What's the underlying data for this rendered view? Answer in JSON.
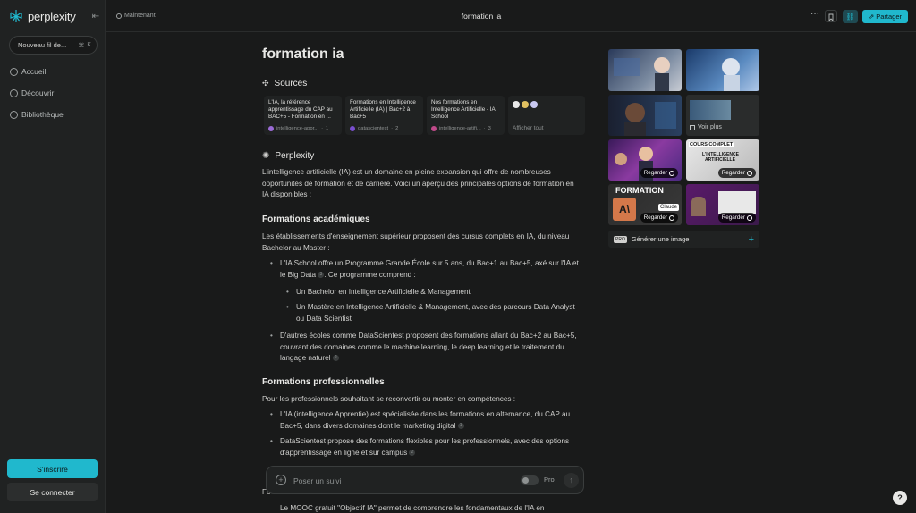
{
  "sidebar": {
    "brand": "perplexity",
    "new_thread": "Nouveau fil de...",
    "new_thread_kbd": "⌘",
    "new_thread_kbd2": "K",
    "items": [
      {
        "label": "Accueil",
        "icon": "search-icon"
      },
      {
        "label": "Découvrir",
        "icon": "globe-icon"
      },
      {
        "label": "Bibliothèque",
        "icon": "library-icon"
      }
    ],
    "signup": "S'inscrire",
    "login": "Se connecter"
  },
  "topbar": {
    "time": "Maintenant",
    "title": "formation ia",
    "share": "Partager"
  },
  "query": "formation ia",
  "sources": {
    "heading": "Sources",
    "cards": [
      {
        "title": "L'IA, la référence apprentissage du CAP au BAC+5 - Formation en ...",
        "domain": "intelligence-appr...",
        "num": "1"
      },
      {
        "title": "Formations en Intelligence Artificielle (IA) | Bac+2 à Bac+5",
        "domain": "datascientest",
        "num": "2"
      },
      {
        "title": "Nos formations en Intelligence Artificielle - IA School",
        "domain": "intelligence-artifi...",
        "num": "3"
      }
    ],
    "show_all": "Afficher tout"
  },
  "answer": {
    "heading": "Perplexity",
    "intro": "L'intelligence artificielle (IA) est un domaine en pleine expansion qui offre de nombreuses opportunités de formation et de carrière. Voici un aperçu des principales options de formation en IA disponibles :",
    "h_academic": "Formations académiques",
    "academic_intro": "Les établissements d'enseignement supérieur proposent des cursus complets en IA, du niveau Bachelor au Master :",
    "academic_1": "L'IA School offre un Programme Grande École sur 5 ans, du Bac+1 au Bac+5, axé sur l'IA et le Big Data",
    "academic_1_cite": "3",
    "academic_1_tail": ". Ce programme comprend :",
    "academic_1a": "Un Bachelor en Intelligence Artificielle & Management",
    "academic_1b": "Un Mastère en Intelligence Artificielle & Management, avec des parcours Data Analyst ou Data Scientist",
    "academic_2": "D'autres écoles comme DataScientest proposent des formations allant du Bac+2 au Bac+5, couvrant des domaines comme le machine learning, le deep learning et le traitement du langage naturel",
    "academic_2_cite": "2",
    "h_pro": "Formations professionnelles",
    "pro_intro": "Pour les professionnels souhaitant se reconvertir ou monter en compétences :",
    "pro_1": "L'IA (intelligence Apprentie) est spécialisée dans les formations en alternance, du CAP au Bac+5, dans divers domaines dont le marketing digital",
    "pro_1_cite": "1",
    "pro_2": "DataScientest propose des formations flexibles pour les professionnels, avec des options d'apprentissage en ligne et sur campus",
    "pro_2_cite": "2",
    "partial_para": "Fo",
    "partial_li": "Le MOOC gratuit \"Objectif IA\" permet de comprendre les fondamentaux de l'IA en"
  },
  "followup": {
    "placeholder": "Poser un suivi",
    "pro_label": "Pro"
  },
  "media": {
    "view_more": "Voir plus",
    "watch": "Regarder",
    "thumb_text_1": "COURS COMPLET",
    "thumb_text_2": "L'INTELLIGENCE ARTIFICIELLE",
    "thumb_text_3": "FORMATION",
    "thumb_text_4": "Claude",
    "generate": "Générer une image",
    "pro_badge": "PRO"
  },
  "colors": {
    "accent": "#20b8cd",
    "background": "#191a1a",
    "sidebar": "#202222"
  }
}
